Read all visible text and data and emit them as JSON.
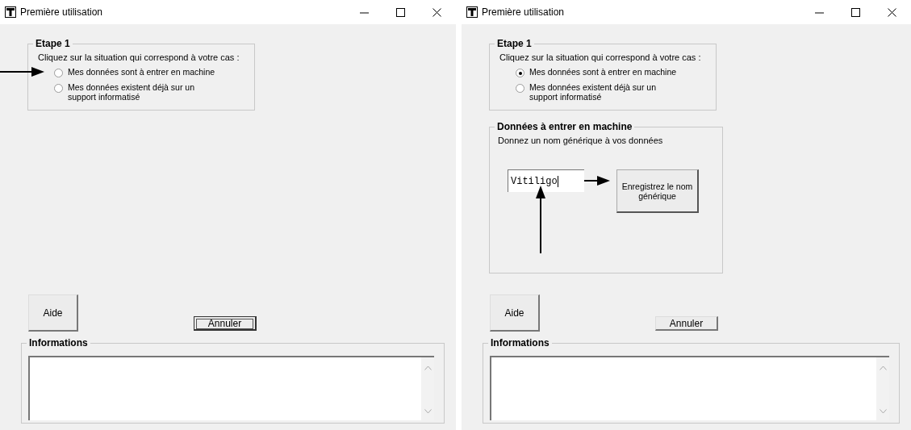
{
  "windows": [
    {
      "title": "Première utilisation",
      "step_group": {
        "title": "Etape 1",
        "instruction": "Cliquez sur la situation qui correspond à votre cas :",
        "options": [
          {
            "label": "Mes données sont à entrer en machine",
            "selected": false,
            "arrow": true
          },
          {
            "label": "Mes données existent déjà sur un support informatisé",
            "selected": false,
            "arrow": false
          }
        ]
      },
      "buttons": [
        {
          "kind": "help",
          "label": "Aide",
          "focused": false
        },
        {
          "kind": "cancel",
          "label": "Annuler",
          "focused": true
        }
      ],
      "info_group": {
        "title": "Informations"
      }
    },
    {
      "title": "Première utilisation",
      "step_group": {
        "title": "Etape 1",
        "instruction": "Cliquez sur la situation qui correspond à votre cas :",
        "options": [
          {
            "label": "Mes données sont à entrer en machine",
            "selected": true,
            "arrow": false
          },
          {
            "label": "Mes données existent déjà sur un support informatisé",
            "selected": false,
            "arrow": false
          }
        ]
      },
      "data_group": {
        "title": "Données à entrer en machine",
        "instruction": "Donnez un nom générique à vos données",
        "name_field": {
          "value": "Vitiligo",
          "arrow": true
        },
        "save_button": {
          "label": "Enregistrez le nom générique"
        }
      },
      "buttons": [
        {
          "kind": "help",
          "label": "Aide",
          "focused": false
        },
        {
          "kind": "cancel",
          "label": "Annuler",
          "focused": false
        }
      ],
      "info_group": {
        "title": "Informations"
      }
    }
  ]
}
